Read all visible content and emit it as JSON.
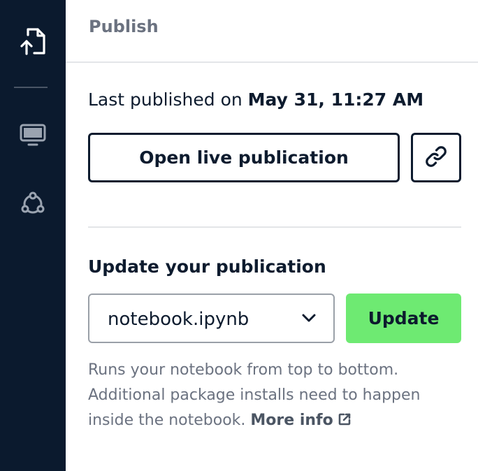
{
  "sidebar": {
    "items": [
      {
        "icon": "file-upload-icon"
      },
      {
        "icon": "monitor-icon"
      },
      {
        "icon": "network-icon"
      }
    ]
  },
  "header": {
    "title": "Publish"
  },
  "status": {
    "prefix": "Last published on",
    "date": "May 31, 11:27 AM"
  },
  "actions": {
    "open_live_label": "Open live publication",
    "copy_link_icon": "link-icon"
  },
  "update": {
    "heading": "Update your publication",
    "select_value": "notebook.ipynb",
    "button_label": "Update",
    "help_text": "Runs your notebook from top to bottom. Additional package installs need to happen inside the notebook.",
    "more_info_label": "More info"
  },
  "colors": {
    "sidebar_bg": "#0b1a2e",
    "accent_green": "#6eea72",
    "text_dark": "#0d1b2e",
    "text_muted": "#6b7280"
  }
}
